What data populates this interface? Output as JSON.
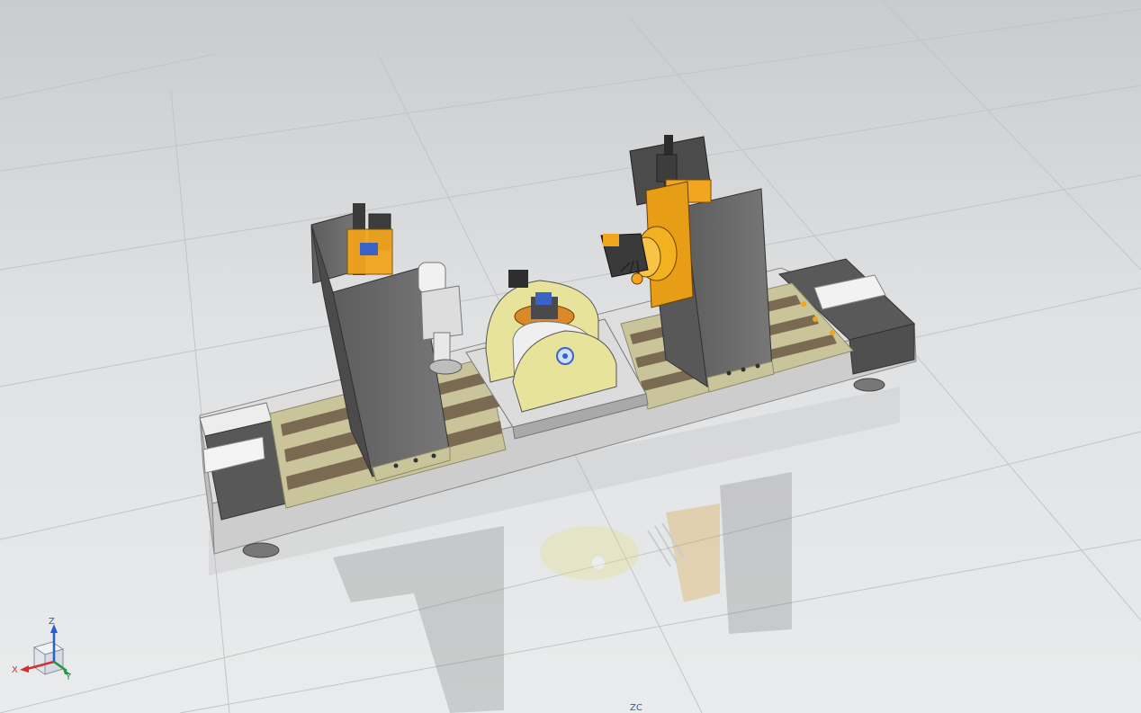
{
  "viewport": {
    "background_top": "#c9cbcd",
    "background_bottom": "#e9ebec",
    "floor_grid": true,
    "reflection": true
  },
  "model": {
    "base_color": "#e4e4e4",
    "column_color": "#6a6a6a",
    "rail_color": "#c9c49a",
    "accent_color": "#f2a51e",
    "fixture_color": "#e8e39a",
    "bolt_color": "#3c63c8"
  },
  "triad": {
    "z_label": "Z",
    "x_label": "X",
    "y_label": "Y",
    "x_color": "#d03030",
    "y_color": "#1f9a3a",
    "z_color": "#2a5fd0",
    "icon": "view-triad-icon"
  },
  "wcs_label": "ZC"
}
